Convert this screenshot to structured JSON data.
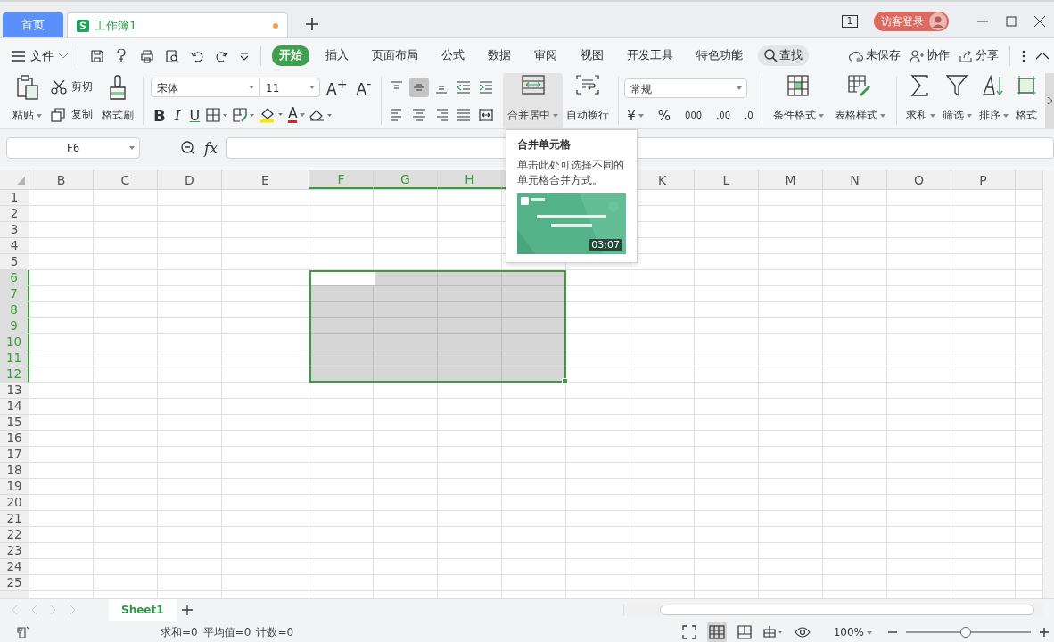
{
  "tabs": [
    {
      "label": "首页",
      "kind": "home",
      "selected": false
    },
    {
      "label": "工作簿1",
      "kind": "sheet",
      "selected": true,
      "modified": true
    }
  ],
  "window": {
    "tab_count": "1",
    "login": "访客登录"
  },
  "menu": {
    "file": "文件",
    "tabs": [
      {
        "label": "开始",
        "selected": true
      },
      {
        "label": "插入",
        "selected": false
      },
      {
        "label": "页面布局",
        "selected": false
      },
      {
        "label": "公式",
        "selected": false
      },
      {
        "label": "数据",
        "selected": false
      },
      {
        "label": "审阅",
        "selected": false
      },
      {
        "label": "视图",
        "selected": false
      },
      {
        "label": "开发工具",
        "selected": false
      },
      {
        "label": "特色功能",
        "selected": false
      }
    ],
    "search": "查找",
    "save_status": "未保存",
    "collaborate": "协作",
    "share": "分享"
  },
  "ribbon": {
    "paste": "粘贴",
    "cut": "剪切",
    "copy": "复制",
    "format_painter": "格式刷",
    "font": "宋体",
    "size": "11",
    "grow_font": "A$^{+}$",
    "shrink_font": "A$^{-}$",
    "bold": "B",
    "italic": "I",
    "underline": "U",
    "font_color": "A",
    "align": [
      {
        "selected": false
      },
      {
        "selected": true
      },
      {
        "selected": false
      }
    ],
    "merge": {
      "label": "合并居中",
      "pressed": true
    },
    "wrap": "自动换行",
    "number_format": "常规",
    "currency": "¥",
    "percent": "%",
    "thousands": "000",
    "decimal_increase": ".00",
    "decimal_decrease": ".0",
    "cond_format": "条件格式",
    "table_style": "表格样式",
    "sum": "求和",
    "filter": "筛选",
    "sort": "排序",
    "format": "格式"
  },
  "formula_bar": {
    "name_box": "F6",
    "fx": "fx"
  },
  "grid": {
    "columns": [
      {
        "label": "B",
        "selected": false
      },
      {
        "label": "C",
        "selected": false
      },
      {
        "label": "D",
        "selected": false
      },
      {
        "label": "E",
        "selected": false
      },
      {
        "label": "F",
        "selected": true
      },
      {
        "label": "G",
        "selected": true
      },
      {
        "label": "H",
        "selected": true
      },
      {
        "selected": true
      },
      {
        "selected": false
      },
      {
        "label": "K",
        "selected": false
      },
      {
        "label": "L",
        "selected": false
      },
      {
        "label": "M",
        "selected": false
      },
      {
        "label": "N",
        "selected": false
      },
      {
        "label": "O",
        "selected": false
      },
      {
        "label": "P",
        "selected": false
      }
    ],
    "rows": [
      {
        "label": "1",
        "selected": false
      },
      {
        "label": "2",
        "selected": false
      },
      {
        "label": "3",
        "selected": false
      },
      {
        "label": "4",
        "selected": false
      },
      {
        "label": "5",
        "selected": false
      },
      {
        "label": "6",
        "selected": true
      },
      {
        "label": "7",
        "selected": true
      },
      {
        "label": "8",
        "selected": true
      },
      {
        "label": "9",
        "selected": true
      },
      {
        "label": "10",
        "selected": true
      },
      {
        "label": "11",
        "selected": true
      },
      {
        "label": "12",
        "selected": true
      },
      {
        "label": "13",
        "selected": false
      },
      {
        "label": "14",
        "selected": false
      },
      {
        "label": "15",
        "selected": false
      },
      {
        "label": "16",
        "selected": false
      },
      {
        "label": "17",
        "selected": false
      },
      {
        "label": "18",
        "selected": false
      },
      {
        "label": "19",
        "selected": false
      },
      {
        "label": "20",
        "selected": false
      },
      {
        "label": "21",
        "selected": false
      },
      {
        "label": "22",
        "selected": false
      },
      {
        "label": "23",
        "selected": false
      },
      {
        "label": "24",
        "selected": false
      },
      {
        "label": "25",
        "selected": false
      }
    ]
  },
  "tooltip": {
    "title": "合并单元格",
    "text": "单击此处可选择不同的单元格合并方式。",
    "duration": "03:07"
  },
  "sheets": [
    {
      "label": "Sheet1",
      "selected": true
    }
  ],
  "status": {
    "stats": [
      "求和=0",
      "平均值=0",
      "计数=0"
    ],
    "zoom": "100%",
    "zoom_level": {
      "level": 0.48
    }
  }
}
